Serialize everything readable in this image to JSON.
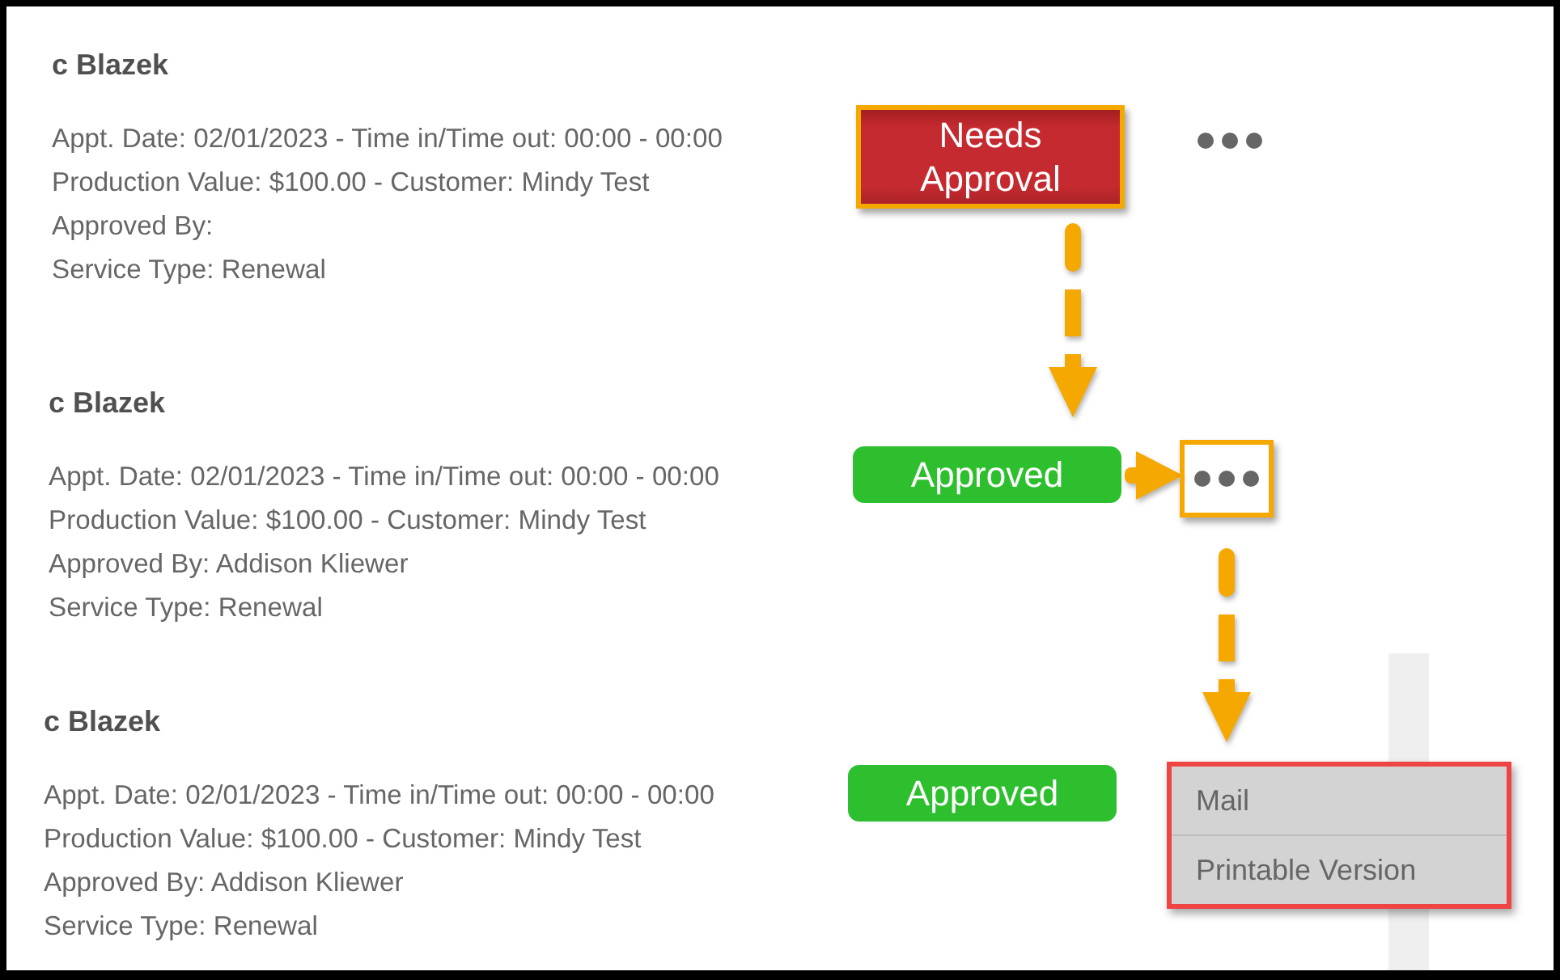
{
  "records": [
    {
      "name": "c Blazek",
      "details": [
        "Appt. Date: 02/01/2023 - Time in/Time out: 00:00 - 00:00",
        "Production Value: $100.00 - Customer: Mindy Test",
        "Approved By:",
        "Service Type: Renewal"
      ],
      "status": {
        "label": "Needs Approval",
        "kind": "needs_approval",
        "outlined": true,
        "arrow_below": true,
        "arrow_dashed": true
      },
      "more_button": {
        "outlined": false
      }
    },
    {
      "name": "c Blazek",
      "details": [
        "Appt. Date: 02/01/2023 - Time in/Time out: 00:00 - 00:00",
        "Production Value: $100.00 - Customer: Mindy Test",
        "Approved By: Addison Kliewer",
        "Service Type: Renewal"
      ],
      "status": {
        "label": "Approved",
        "kind": "approved",
        "outlined": false,
        "arrow_right": true,
        "arrow_dashed": false
      },
      "more_button": {
        "outlined": true,
        "arrow_below": true,
        "arrow_dashed": true
      }
    },
    {
      "name": "c Blazek",
      "details": [
        "Appt. Date: 02/01/2023 - Time in/Time out: 00:00 - 00:00",
        "Production Value: $100.00 - Customer: Mindy Test",
        "Approved By: Addison Kliewer",
        "Service Type: Renewal"
      ],
      "status": {
        "label": "Approved",
        "kind": "approved",
        "outlined": false
      },
      "menu": {
        "outlined": true,
        "items": [
          {
            "label": "Mail"
          },
          {
            "label": "Printable Version"
          }
        ]
      }
    }
  ]
}
